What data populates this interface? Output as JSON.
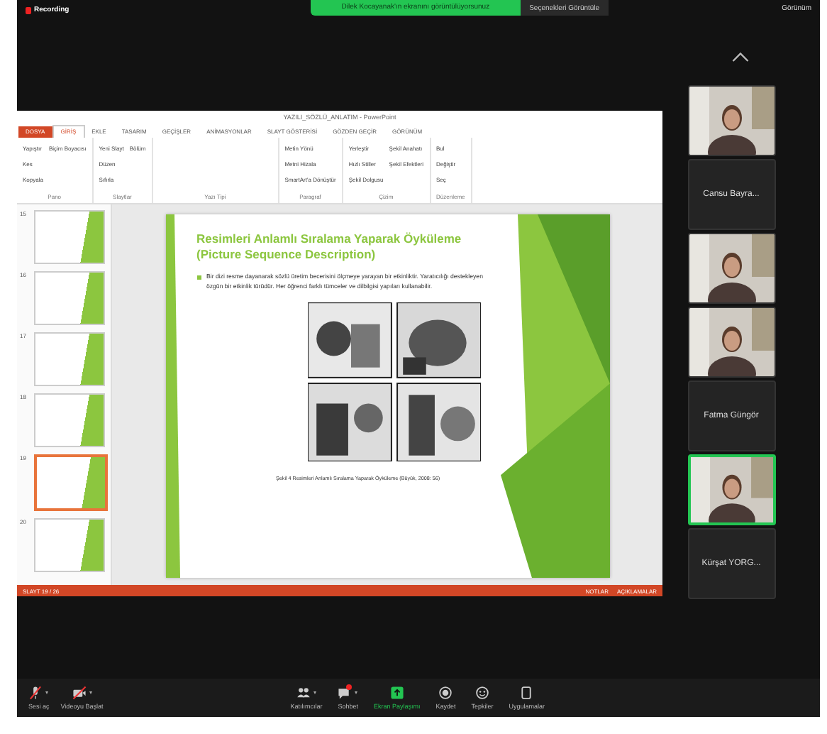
{
  "top_bar": {
    "recording": "Recording",
    "banner": "Dilek Kocayanak'ın ekranını görüntülüyorsunuz",
    "banner_options": "Seçenekleri Görüntüle",
    "view": "Görünüm"
  },
  "powerpoint": {
    "title": "YAZILI_SÖZLÜ_ANLATIM - PowerPoint",
    "tabs": [
      {
        "label": "DOSYA",
        "kind": "file",
        "selected": false
      },
      {
        "label": "GİRİŞ",
        "kind": "tab",
        "selected": true
      },
      {
        "label": "EKLE",
        "kind": "tab",
        "selected": false
      },
      {
        "label": "TASARIM",
        "kind": "tab",
        "selected": false
      },
      {
        "label": "GEÇİŞLER",
        "kind": "tab",
        "selected": false
      },
      {
        "label": "ANİMASYONLAR",
        "kind": "tab",
        "selected": false
      },
      {
        "label": "SLAYT GÖSTERİSİ",
        "kind": "tab",
        "selected": false
      },
      {
        "label": "GÖZDEN GEÇİR",
        "kind": "tab",
        "selected": false
      },
      {
        "label": "GÖRÜNÜM",
        "kind": "tab",
        "selected": false
      }
    ],
    "ribbon_groups": [
      {
        "label": "Pano",
        "buttons": [
          "Yapıştır",
          "Kes",
          "Kopyala",
          "Biçim Boyacısı"
        ]
      },
      {
        "label": "Slaytlar",
        "buttons": [
          "Yeni Slayt",
          "Düzen",
          "Sıfırla",
          "Bölüm"
        ]
      },
      {
        "label": "Yazı Tipi"
      },
      {
        "label": "Paragraf",
        "buttons": [
          "Metin Yönü",
          "Metni Hizala",
          "SmartArt'a Dönüştür"
        ]
      },
      {
        "label": "Çizim",
        "buttons": [
          "Yerleştir",
          "Hızlı Stiller",
          "Şekil Dolgusu",
          "Şekil Anahatı",
          "Şekil Efektleri"
        ]
      },
      {
        "label": "Düzenleme",
        "buttons": [
          "Bul",
          "Değiştir",
          "Seç"
        ]
      }
    ],
    "thumbnails": [
      {
        "number": "15",
        "selected": false
      },
      {
        "number": "16",
        "selected": false
      },
      {
        "number": "17",
        "selected": false
      },
      {
        "number": "18",
        "selected": false
      },
      {
        "number": "19",
        "selected": true
      },
      {
        "number": "20",
        "selected": false
      }
    ],
    "slide": {
      "title": "Resimleri Anlamlı Sıralama Yaparak Öyküleme",
      "subtitle": "(Picture Sequence Description)",
      "bullet": "Bir dizi resme dayanarak sözlü üretim becerisini ölçmeye yarayan bir etkinliktir. Yaratıcılığı destekleyen özgün bir etkinlik türüdür. Her öğrenci farklı tümceler ve dilbilgisi yapıları kullanabilir.",
      "caption": "Şekil 4 Resimleri Anlamlı Sıralama Yaparak Öyküleme (Büyük, 2008: 56)"
    },
    "status_bar": {
      "slide_count": "SLAYT 19 / 26",
      "notes": "NOTLAR",
      "comments": "AÇIKLAMALAR"
    }
  },
  "participants": [
    {
      "kind": "video",
      "speaking": false
    },
    {
      "kind": "name",
      "name": "Cansu Bayra..."
    },
    {
      "kind": "video",
      "speaking": false
    },
    {
      "kind": "video",
      "speaking": false
    },
    {
      "kind": "name",
      "name": "Fatma Güngör"
    },
    {
      "kind": "video",
      "speaking": true
    },
    {
      "kind": "name",
      "name": "Kürşat YORG..."
    }
  ],
  "toolbar": [
    {
      "label": "Sesi aç",
      "kind": "mic-off",
      "caret": true
    },
    {
      "label": "Videoyu Başlat",
      "kind": "video-off",
      "caret": true
    },
    {
      "label": "Katılımcılar",
      "kind": "people",
      "caret": true
    },
    {
      "label": "Sohbet",
      "kind": "chat",
      "caret": true,
      "unread": true
    },
    {
      "label": "Ekran Paylaşımı",
      "kind": "share",
      "caret": false
    },
    {
      "label": "Kaydet",
      "kind": "record",
      "caret": false
    },
    {
      "label": "Tepkiler",
      "kind": "reactions",
      "caret": false
    },
    {
      "label": "Uygulamalar",
      "kind": "apps",
      "caret": false
    }
  ]
}
